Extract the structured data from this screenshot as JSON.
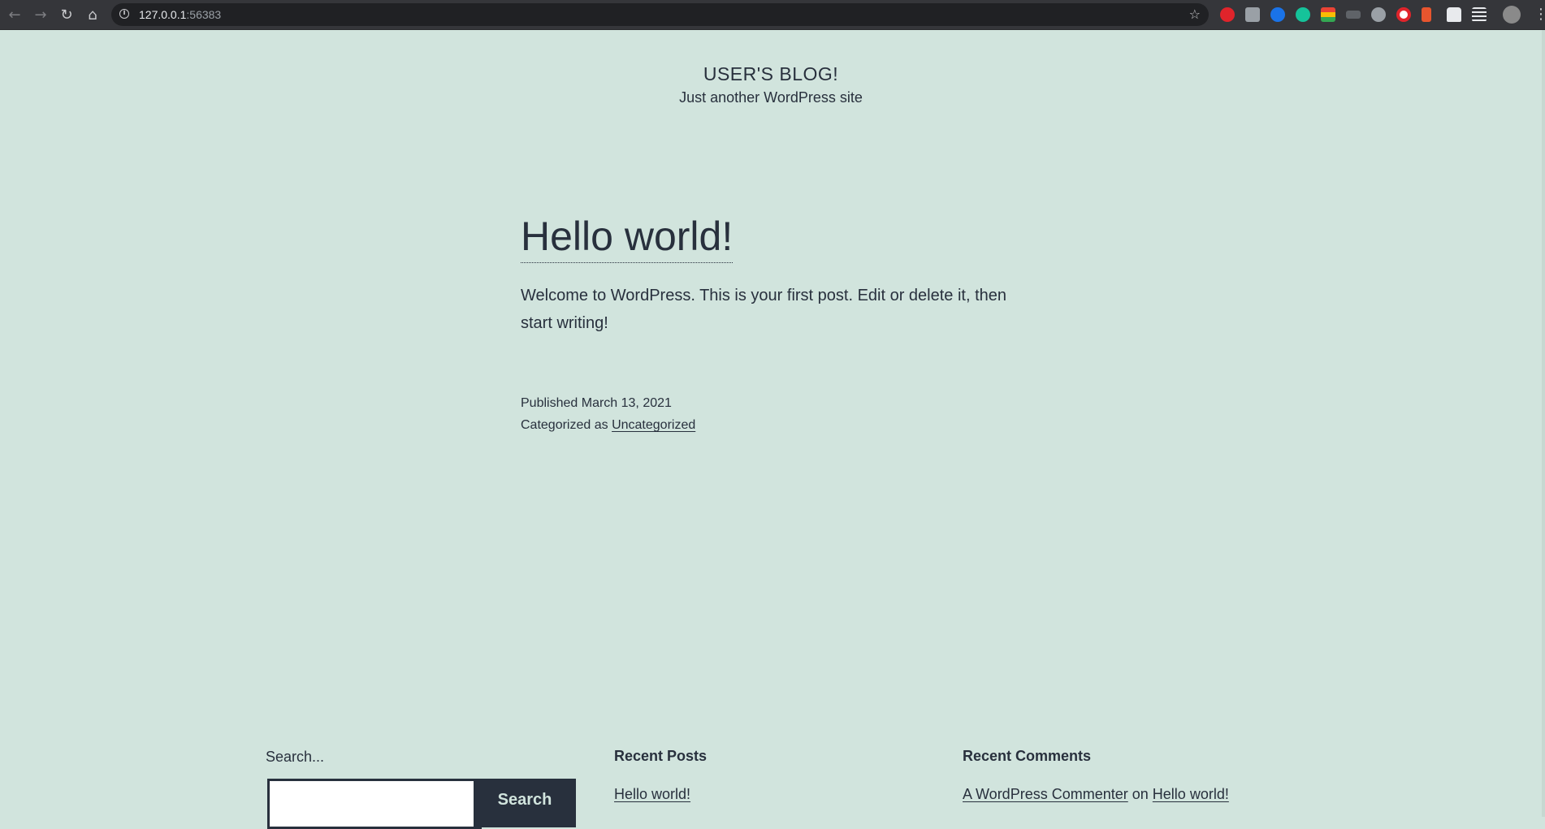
{
  "browser": {
    "url_host": "127.0.0.1",
    "url_port": ":56383",
    "nav": {
      "back": "←",
      "forward": "→",
      "reload": "↻",
      "home": "⌂"
    },
    "icons": [
      "info-icon",
      "star-icon",
      "puzzle-extensions-icon",
      "reading-list-icon",
      "profile-avatar-icon",
      "menu-dots-icon"
    ]
  },
  "site": {
    "title": "USER'S BLOG!",
    "description": "Just another WordPress site"
  },
  "post": {
    "title": "Hello world!",
    "content": "Welcome to WordPress. This is your first post. Edit or delete it, then start writing!",
    "published_label": "Published",
    "published_date": "March 13, 2021",
    "categorized_label": "Categorized as",
    "category": "Uncategorized"
  },
  "footer": {
    "search": {
      "label": "Search...",
      "button_label": "Search",
      "value": ""
    },
    "recent_posts": {
      "title": "Recent Posts",
      "items": [
        {
          "label": "Hello world!"
        }
      ]
    },
    "recent_comments": {
      "title": "Recent Comments",
      "items": [
        {
          "author": "A WordPress Commenter",
          "joiner": "on",
          "post": "Hello world!"
        }
      ]
    }
  },
  "colors": {
    "background": "#d1e4dd",
    "text": "#28303d",
    "browser_bar": "#35363a",
    "omnibox": "#202124"
  }
}
